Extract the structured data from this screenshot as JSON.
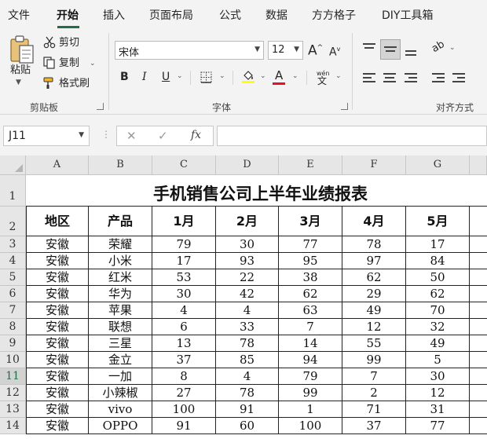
{
  "menu": {
    "tabs": [
      {
        "label": "文件",
        "active": false
      },
      {
        "label": "开始",
        "active": true
      },
      {
        "label": "插入",
        "active": false
      },
      {
        "label": "页面布局",
        "active": false
      },
      {
        "label": "公式",
        "active": false
      },
      {
        "label": "数据",
        "active": false
      },
      {
        "label": "方方格子",
        "active": false
      },
      {
        "label": "DIY工具箱",
        "active": false
      }
    ]
  },
  "ribbon": {
    "clipboard": {
      "paste_label": "粘贴",
      "cut_label": "剪切",
      "copy_label": "复制",
      "format_painter_label": "格式刷",
      "group_label": "剪贴板"
    },
    "font": {
      "font_name": "宋体",
      "font_size": "12",
      "grow_label": "A",
      "shrink_label": "A",
      "bold_label": "B",
      "italic_label": "I",
      "underline_label": "U",
      "font_color_label": "A",
      "phonetic_label": "wén",
      "group_label": "字体",
      "highlight_color": "#ffff00",
      "font_color": "#e81123"
    },
    "alignment": {
      "group_label": "对齐方式"
    }
  },
  "formula_bar": {
    "name_box": "J11",
    "cancel_symbol": "✕",
    "enter_symbol": "✓",
    "fx_symbol": "fx",
    "formula": ""
  },
  "grid": {
    "columns": [
      "A",
      "B",
      "C",
      "D",
      "E",
      "F",
      "G"
    ],
    "row_numbers": [
      "1",
      "2",
      "3",
      "4",
      "5",
      "6",
      "7",
      "8",
      "9",
      "10",
      "11",
      "12",
      "13",
      "14"
    ],
    "selected_row": "11",
    "title": "手机销售公司上半年业绩报表",
    "headers": [
      "地区",
      "产品",
      "1月",
      "2月",
      "3月",
      "4月",
      "5月"
    ],
    "rows": [
      [
        "安徽",
        "荣耀",
        "79",
        "30",
        "77",
        "78",
        "17"
      ],
      [
        "安徽",
        "小米",
        "17",
        "93",
        "95",
        "97",
        "84"
      ],
      [
        "安徽",
        "红米",
        "53",
        "22",
        "38",
        "62",
        "50"
      ],
      [
        "安徽",
        "华为",
        "30",
        "42",
        "62",
        "29",
        "62"
      ],
      [
        "安徽",
        "苹果",
        "4",
        "4",
        "63",
        "49",
        "70"
      ],
      [
        "安徽",
        "联想",
        "6",
        "33",
        "7",
        "12",
        "32"
      ],
      [
        "安徽",
        "三星",
        "13",
        "78",
        "14",
        "55",
        "49"
      ],
      [
        "安徽",
        "金立",
        "37",
        "85",
        "94",
        "99",
        "5"
      ],
      [
        "安徽",
        "一加",
        "8",
        "4",
        "79",
        "7",
        "30"
      ],
      [
        "安徽",
        "小辣椒",
        "27",
        "78",
        "99",
        "2",
        "12"
      ],
      [
        "安徽",
        "vivo",
        "100",
        "91",
        "1",
        "71",
        "31"
      ],
      [
        "安徽",
        "OPPO",
        "91",
        "60",
        "100",
        "37",
        "77"
      ]
    ]
  },
  "colors": {
    "accent": "#1f7145",
    "ribbon_bg": "#f3f3f3",
    "header_bg": "#e6e6e6"
  }
}
